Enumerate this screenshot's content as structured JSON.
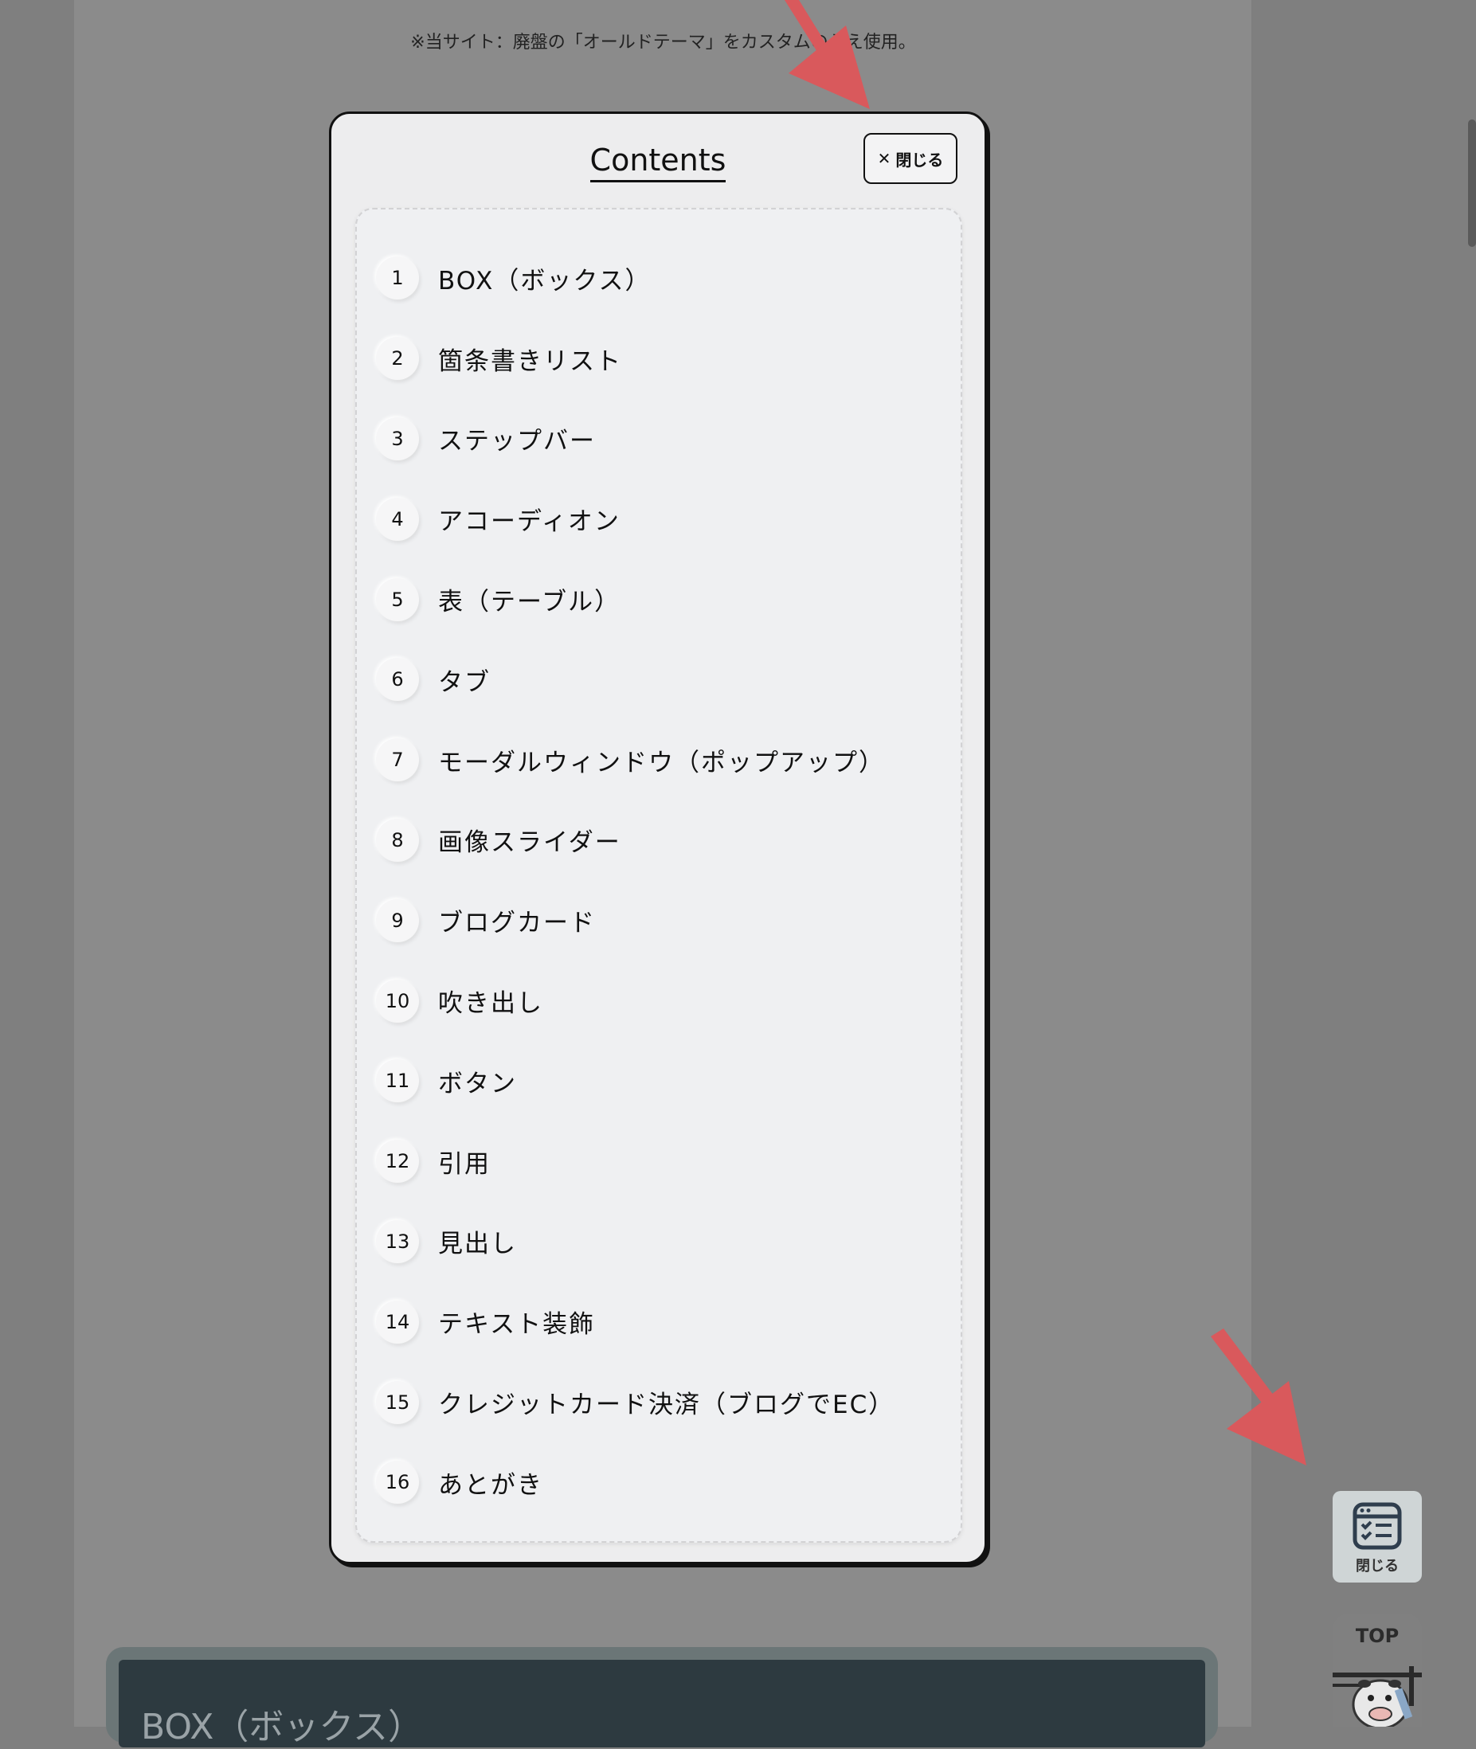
{
  "page": {
    "note": "※当サイト：廃盤の「オールドテーマ」をカスタムのうえ使用。",
    "next_heading": "BOX（ボックス）"
  },
  "modal": {
    "title": "Contents",
    "close_label": "閉じる",
    "close_icon": "close-icon",
    "items": [
      {
        "num": "1",
        "label": "BOX（ボックス）"
      },
      {
        "num": "2",
        "label": "箇条書きリスト"
      },
      {
        "num": "3",
        "label": "ステップバー"
      },
      {
        "num": "4",
        "label": "アコーディオン"
      },
      {
        "num": "5",
        "label": "表（テーブル）"
      },
      {
        "num": "6",
        "label": "タブ"
      },
      {
        "num": "7",
        "label": "モーダルウィンドウ（ポップアップ）"
      },
      {
        "num": "8",
        "label": "画像スライダー"
      },
      {
        "num": "9",
        "label": "ブログカード"
      },
      {
        "num": "10",
        "label": "吹き出し"
      },
      {
        "num": "11",
        "label": "ボタン"
      },
      {
        "num": "12",
        "label": "引用"
      },
      {
        "num": "13",
        "label": "見出し"
      },
      {
        "num": "14",
        "label": "テキスト装飾"
      },
      {
        "num": "15",
        "label": "クレジットカード決済（ブログでEC）"
      },
      {
        "num": "16",
        "label": "あとがき"
      }
    ]
  },
  "floating": {
    "toc_button_label": "閉じる",
    "toc_icon": "checklist-icon",
    "top_label": "TOP"
  },
  "colors": {
    "overlay": "#7f7f7f",
    "annotation_arrow": "#d9595c",
    "modal_bg": "#ededee"
  }
}
